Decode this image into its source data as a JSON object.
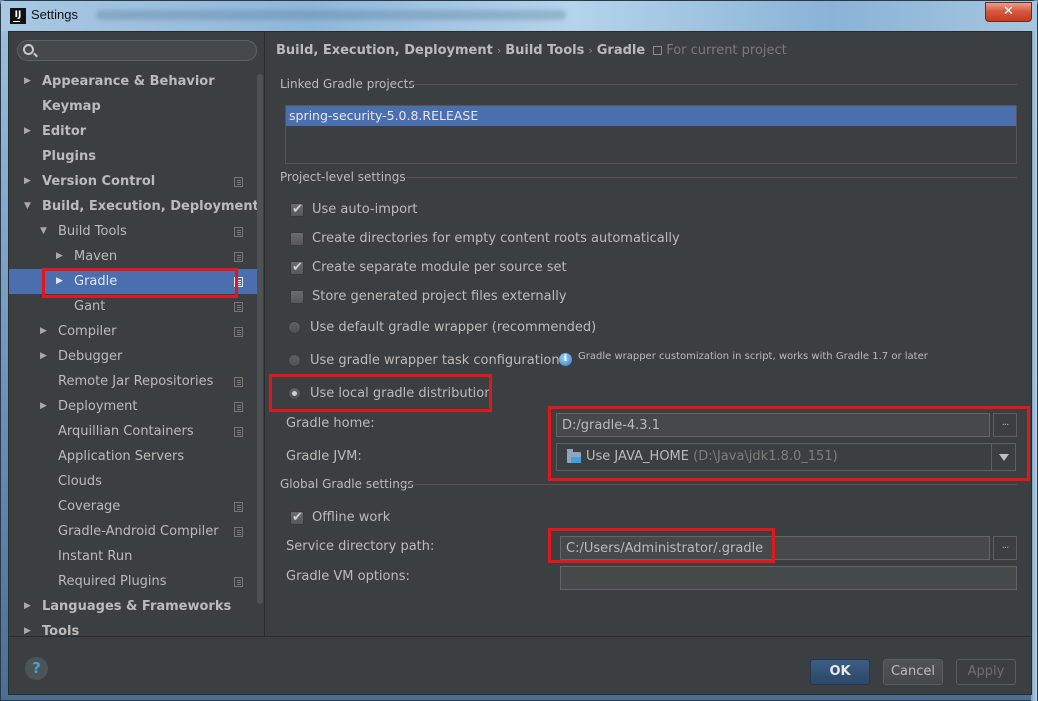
{
  "window": {
    "title": "Settings",
    "app_icon": "IJ",
    "close_label": "✕"
  },
  "sidebar": {
    "search": {
      "placeholder": "",
      "value": ""
    },
    "items": [
      {
        "label": "Appearance & Behavior",
        "level": 0,
        "expander": "collapsed",
        "bold": true,
        "project_icon": false,
        "selected": false
      },
      {
        "label": "Keymap",
        "level": 0,
        "expander": "none",
        "bold": true,
        "project_icon": false,
        "selected": false
      },
      {
        "label": "Editor",
        "level": 0,
        "expander": "collapsed",
        "bold": true,
        "project_icon": false,
        "selected": false
      },
      {
        "label": "Plugins",
        "level": 0,
        "expander": "none",
        "bold": true,
        "project_icon": false,
        "selected": false
      },
      {
        "label": "Version Control",
        "level": 0,
        "expander": "collapsed",
        "bold": true,
        "project_icon": true,
        "selected": false
      },
      {
        "label": "Build, Execution, Deployment",
        "level": 0,
        "expander": "expanded",
        "bold": true,
        "project_icon": false,
        "selected": false
      },
      {
        "label": "Build Tools",
        "level": 1,
        "expander": "expanded",
        "bold": false,
        "project_icon": true,
        "selected": false
      },
      {
        "label": "Maven",
        "level": 2,
        "expander": "collapsed",
        "bold": false,
        "project_icon": true,
        "selected": false
      },
      {
        "label": "Gradle",
        "level": 2,
        "expander": "collapsed",
        "bold": false,
        "project_icon": true,
        "selected": true
      },
      {
        "label": "Gant",
        "level": 2,
        "expander": "none",
        "bold": false,
        "project_icon": true,
        "selected": false
      },
      {
        "label": "Compiler",
        "level": 1,
        "expander": "collapsed",
        "bold": false,
        "project_icon": true,
        "selected": false
      },
      {
        "label": "Debugger",
        "level": 1,
        "expander": "collapsed",
        "bold": false,
        "project_icon": false,
        "selected": false
      },
      {
        "label": "Remote Jar Repositories",
        "level": 1,
        "expander": "none",
        "bold": false,
        "project_icon": true,
        "selected": false
      },
      {
        "label": "Deployment",
        "level": 1,
        "expander": "collapsed",
        "bold": false,
        "project_icon": true,
        "selected": false
      },
      {
        "label": "Arquillian Containers",
        "level": 1,
        "expander": "none",
        "bold": false,
        "project_icon": true,
        "selected": false
      },
      {
        "label": "Application Servers",
        "level": 1,
        "expander": "none",
        "bold": false,
        "project_icon": false,
        "selected": false
      },
      {
        "label": "Clouds",
        "level": 1,
        "expander": "none",
        "bold": false,
        "project_icon": false,
        "selected": false
      },
      {
        "label": "Coverage",
        "level": 1,
        "expander": "none",
        "bold": false,
        "project_icon": true,
        "selected": false
      },
      {
        "label": "Gradle-Android Compiler",
        "level": 1,
        "expander": "none",
        "bold": false,
        "project_icon": true,
        "selected": false
      },
      {
        "label": "Instant Run",
        "level": 1,
        "expander": "none",
        "bold": false,
        "project_icon": false,
        "selected": false
      },
      {
        "label": "Required Plugins",
        "level": 1,
        "expander": "none",
        "bold": false,
        "project_icon": true,
        "selected": false
      },
      {
        "label": "Languages & Frameworks",
        "level": 0,
        "expander": "collapsed",
        "bold": true,
        "project_icon": false,
        "selected": false
      },
      {
        "label": "Tools",
        "level": 0,
        "expander": "collapsed",
        "bold": true,
        "project_icon": false,
        "selected": false
      }
    ]
  },
  "main": {
    "breadcrumb": {
      "parts": [
        "Build, Execution, Deployment",
        "Build Tools",
        "Gradle"
      ],
      "separator": "›",
      "scope": "For current project"
    },
    "linked_projects": {
      "title": "Linked Gradle projects",
      "items": [
        "spring-security-5.0.8.RELEASE"
      ],
      "selected_index": 0
    },
    "project_level": {
      "title": "Project-level settings",
      "checkboxes": [
        {
          "label": "Use auto-import",
          "checked": true
        },
        {
          "label": "Create directories for empty content roots automatically",
          "checked": false
        },
        {
          "label": "Create separate module per source set",
          "checked": true
        },
        {
          "label": "Store generated project files externally",
          "checked": false
        }
      ],
      "radios": [
        {
          "label": "Use default gradle wrapper (recommended)",
          "checked": false
        },
        {
          "label": "Use gradle wrapper task configuration",
          "checked": false
        },
        {
          "label": "Use local gradle distribution",
          "checked": true
        }
      ],
      "wrapper_note": "Gradle wrapper customization in script, works with Gradle 1.7 or later",
      "gradle_home": {
        "label": "Gradle home:",
        "value": "D:/gradle-4.3.1",
        "browse_label": "..."
      },
      "gradle_jvm": {
        "label": "Gradle JVM:",
        "value": "Use JAVA_HOME",
        "hint": "(D:\\Java\\jdk1.8.0_151)"
      }
    },
    "global": {
      "title": "Global Gradle settings",
      "offline_work": {
        "label": "Offline work",
        "checked": true
      },
      "service_dir": {
        "label": "Service directory path:",
        "value": "C:/Users/Administrator/.gradle",
        "browse_label": "..."
      },
      "vm_options": {
        "label": "Gradle VM options:",
        "value": ""
      }
    }
  },
  "footer": {
    "help_label": "?",
    "ok_label": "OK",
    "cancel_label": "Cancel",
    "apply_label": "Apply"
  },
  "colors": {
    "background": "#3c3f41",
    "selection": "#4b6eaf",
    "highlight_box": "#e3161c",
    "text": "#bbbbbb"
  }
}
